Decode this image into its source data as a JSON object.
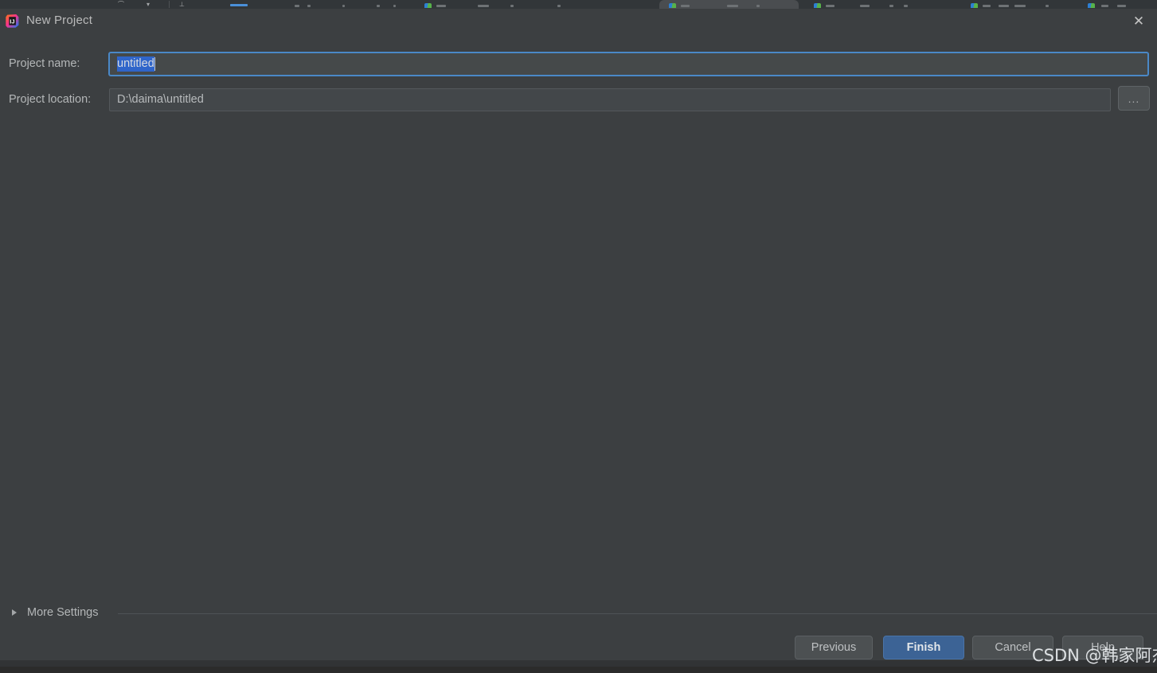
{
  "window": {
    "title": "New Project",
    "app_icon": "intellij-idea-logo",
    "close_icon": "close-icon"
  },
  "form": {
    "project_name": {
      "label": "Project name:",
      "value": "untitled",
      "selected": true
    },
    "project_location": {
      "label": "Project location:",
      "value": "D:\\daima\\untitled",
      "browse_label": "..."
    }
  },
  "more_settings": {
    "label": "More Settings",
    "expanded": false,
    "arrow_icon": "chevron-right-icon"
  },
  "buttons": {
    "previous": "Previous",
    "finish": "Finish",
    "cancel": "Cancel",
    "help": "Help"
  },
  "watermark": {
    "text": "CSDN @韩家阿杰"
  },
  "colors": {
    "dialog_background": "#3c3f41",
    "field_background": "#45494a",
    "focus_border": "#4a88c7",
    "selection": "#2f65ca",
    "primary_button": "#3c6395",
    "text": "#b4b7b8",
    "tabstrip_background": "#323639"
  }
}
